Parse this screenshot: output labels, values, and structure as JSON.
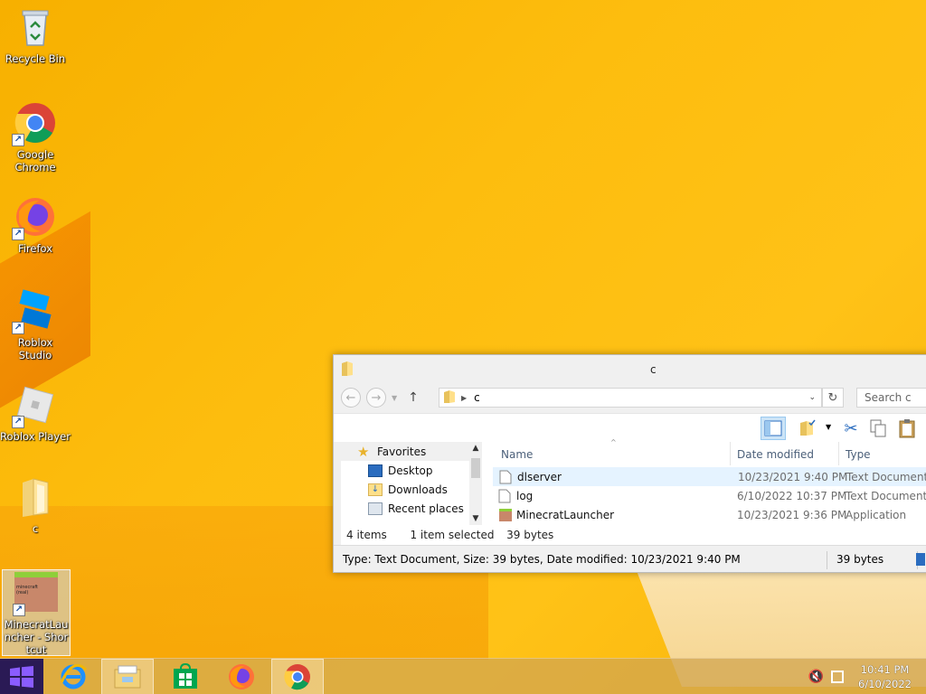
{
  "desktop": {
    "icons": [
      {
        "label": "Recycle Bin",
        "icon": "recycle-bin-icon"
      },
      {
        "label": "Google Chrome",
        "icon": "chrome-icon"
      },
      {
        "label": "Firefox",
        "icon": "firefox-icon"
      },
      {
        "label": "Roblox Studio",
        "icon": "roblox-studio-icon"
      },
      {
        "label": "Roblox Player",
        "icon": "roblox-player-icon"
      },
      {
        "label": "c",
        "icon": "folder-icon"
      },
      {
        "label": "MinecratLauncher - Shortcut",
        "icon": "minecraft-shortcut-icon",
        "thumb_text": "minecraft (real)"
      }
    ]
  },
  "explorer": {
    "title": "c",
    "address_path": "c",
    "search_placeholder": "Search c",
    "nav_pane": [
      {
        "label": "Favorites",
        "icon": "star-icon"
      },
      {
        "label": "Desktop",
        "icon": "desktop-icon"
      },
      {
        "label": "Downloads",
        "icon": "downloads-icon"
      },
      {
        "label": "Recent places",
        "icon": "recent-places-icon"
      }
    ],
    "columns": {
      "name": "Name",
      "date": "Date modified",
      "type": "Type"
    },
    "files": [
      {
        "name": "dlserver",
        "date": "10/23/2021 9:40 PM",
        "type": "Text Document",
        "selected": true,
        "icon": "text-file-icon"
      },
      {
        "name": "log",
        "date": "6/10/2022 10:37 PM",
        "type": "Text Document",
        "selected": false,
        "icon": "text-file-icon"
      },
      {
        "name": "MinecratLauncher",
        "date": "10/23/2021 9:36 PM",
        "type": "Application",
        "selected": false,
        "icon": "application-icon"
      }
    ],
    "count_text": "4 items",
    "selected_text": "1 item selected",
    "selected_size": "39 bytes",
    "status_text": "Type: Text Document, Size: 39 bytes, Date modified: 10/23/2021 9:40 PM",
    "status_size": "39 bytes"
  },
  "taskbar": {
    "items": [
      "internet-explorer-icon",
      "file-explorer-icon",
      "store-icon",
      "firefox-icon",
      "chrome-icon"
    ],
    "time": "10:41 PM",
    "date": "6/10/2022"
  },
  "colors": {
    "wallpaper": "#fdbd0e",
    "selection": "#e5f3ff",
    "start": "#2a1a55"
  }
}
